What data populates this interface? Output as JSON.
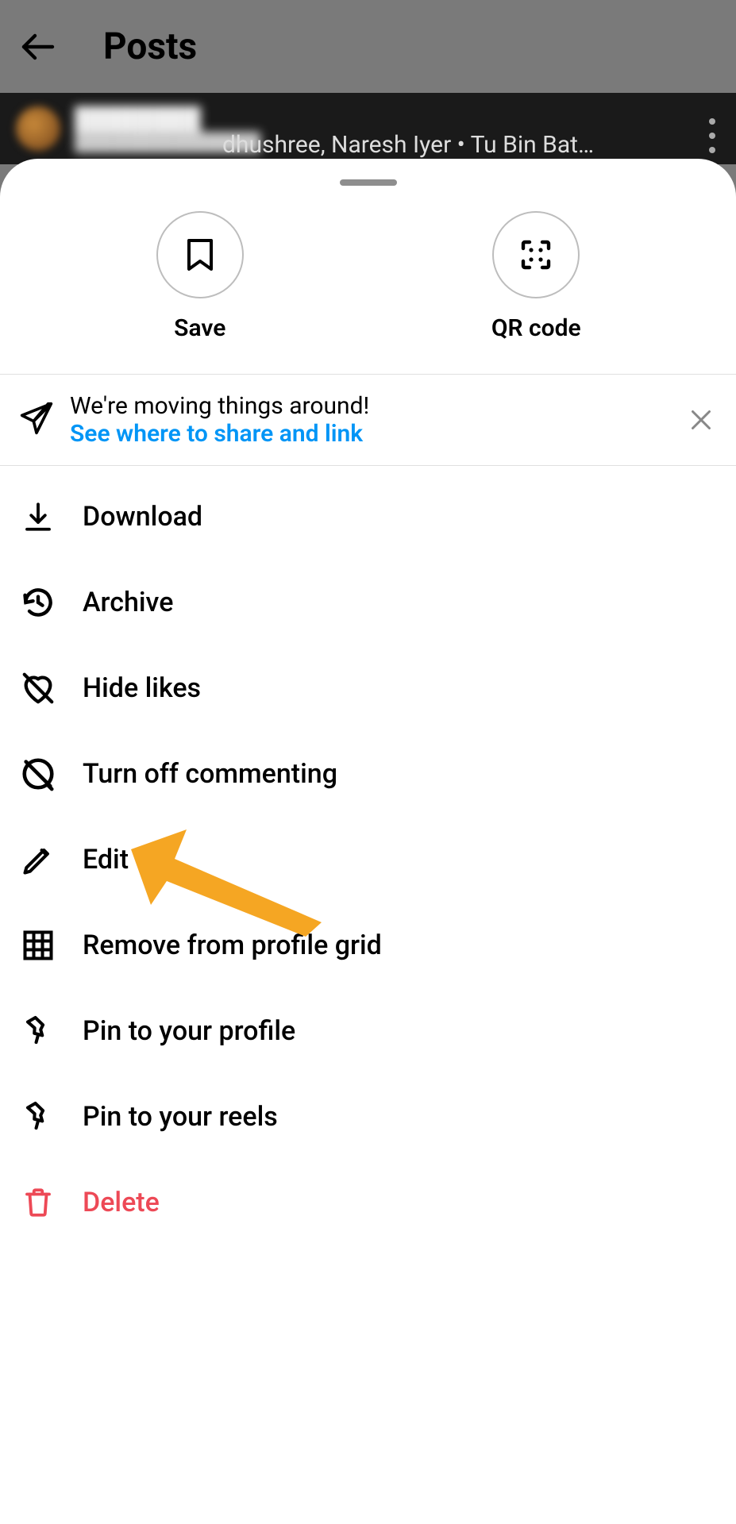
{
  "header": {
    "title": "Posts"
  },
  "post": {
    "audio_text": "dhushree, Naresh Iyer • Tu Bin Bat…"
  },
  "sheet": {
    "top_actions": {
      "save": "Save",
      "qr": "QR code"
    },
    "notice": {
      "headline": "We're moving things around!",
      "link": "See where to share and link"
    },
    "items": {
      "download": "Download",
      "archive": "Archive",
      "hide_likes": "Hide likes",
      "turn_off_commenting": "Turn off commenting",
      "edit": "Edit",
      "remove_grid": "Remove from profile grid",
      "pin_profile": "Pin to your profile",
      "pin_reels": "Pin to your reels",
      "delete": "Delete"
    }
  },
  "colors": {
    "link": "#0095f6",
    "danger": "#ed4956"
  }
}
